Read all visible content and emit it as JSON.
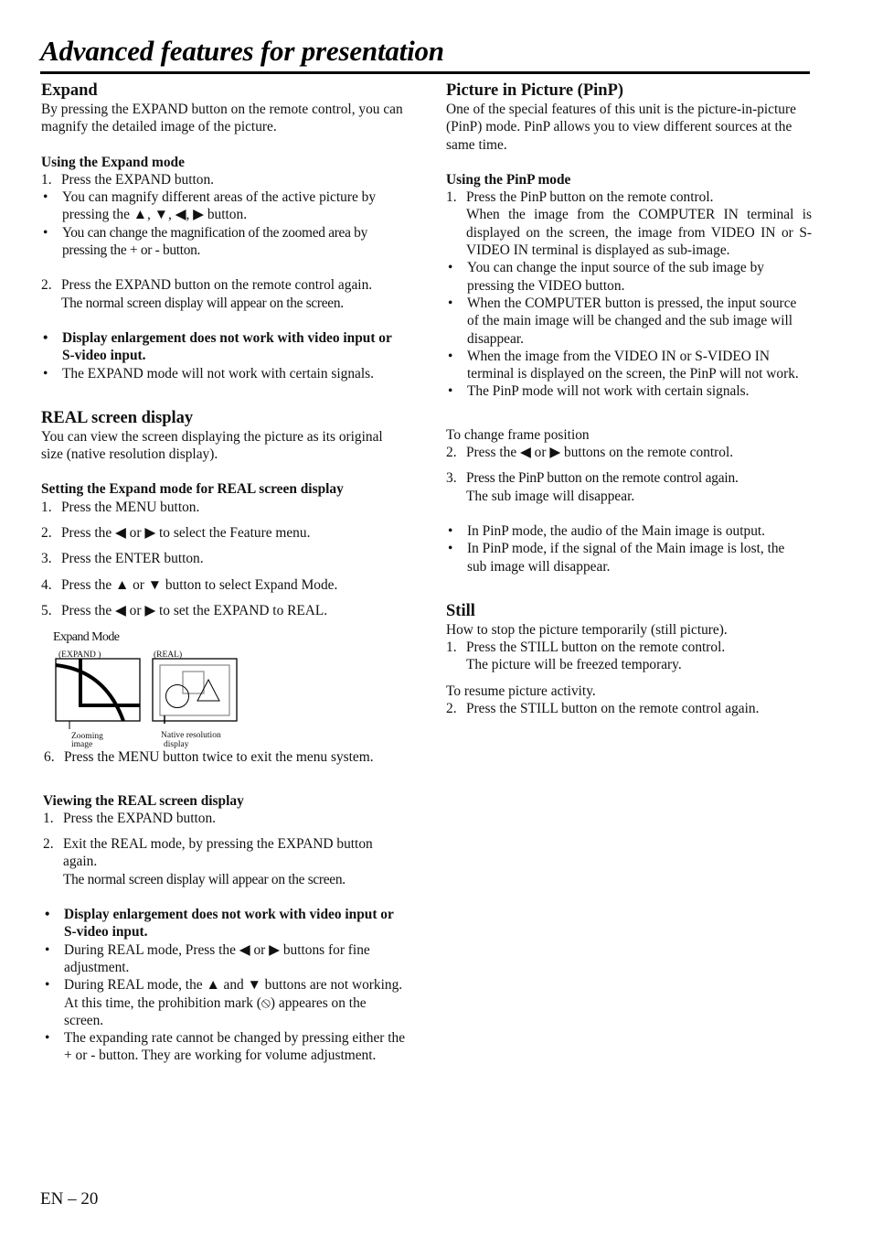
{
  "page": {
    "title": "Advanced features for presentation",
    "footer": "EN – 20"
  },
  "expand": {
    "heading": "Expand",
    "intro": "By pressing the EXPAND button on the remote control, you can magnify the detailed image of the picture.",
    "using_heading": "Using the Expand mode",
    "step1_num": "1.",
    "step1": "Press the EXPAND button.",
    "bullet1": "You can magnify different areas of the active picture by pressing the ▲, ▼, ◀, ▶ button.",
    "bullet2": "You can change the magnification of the zoomed area by pressing the + or - button.",
    "step2_num": "2.",
    "step2": "Press the EXPAND button on the remote control again.",
    "step2_note": "The normal screen display will appear on the screen.",
    "note1": "Display enlargement does not work with video input or S-video input.",
    "note2": "The EXPAND mode will not work with certain signals.",
    "bullet_mark": "•"
  },
  "real": {
    "heading": "REAL screen display",
    "intro": "You can view the screen displaying the picture as its original size (native resolution display).",
    "setting_heading": "Setting the Expand mode for REAL screen display",
    "steps": [
      {
        "num": "1.",
        "text": "Press the MENU button."
      },
      {
        "num": "2.",
        "text": "Press the ◀ or ▶ to select the Feature menu."
      },
      {
        "num": "3.",
        "text": "Press the ENTER button."
      },
      {
        "num": "4.",
        "text": "Press the  ▲ or ▼ button to select Expand Mode."
      },
      {
        "num": "5.",
        "text": "Press the ◀ or ▶ to set the EXPAND to REAL."
      }
    ],
    "diagram": {
      "title": "Expand Mode",
      "left_label": "(EXPAND )",
      "right_label": "(REAL)",
      "left_caption_1": "Zooming",
      "left_caption_2": "image",
      "right_caption_1": "Native resolution",
      "right_caption_2": "display"
    },
    "step6_num": "6.",
    "step6": "Press the MENU button twice to exit the menu system.",
    "viewing_heading": "Viewing the REAL screen display",
    "view_step1_num": "1.",
    "view_step1": "Press the EXPAND button.",
    "view_step2_num": "2.",
    "view_step2": "Exit the REAL mode, by pressing the EXPAND button again.",
    "view_step2_note": "The normal screen display will appear on the screen.",
    "note1": "Display enlargement does not work with video input or S-video input.",
    "note2": "During REAL mode, Press the ◀ or ▶ buttons for fine adjustment.",
    "note3": "During REAL mode, the ▲ and ▼ buttons are not working. At this time, the prohibition mark (⦸) appeares on the screen.",
    "note4": "The expanding rate cannot be changed by pressing either the + or - button. They are working for volume adjustment."
  },
  "pinp": {
    "heading": "Picture in Picture (PinP)",
    "intro": "One of the special features of this unit is the picture-in-picture (PinP) mode. PinP allows you to view different sources at the same time.",
    "using_heading": "Using the PinP mode",
    "step1_num": "1.",
    "step1": "Press the PinP button on the remote control.",
    "step1_note": "When the image from the COMPUTER IN terminal is displayed on the screen, the image from VIDEO IN or S-VIDEO IN terminal is displayed as sub-image.",
    "bullets": [
      "You can change the input source of the sub image by pressing the VIDEO button.",
      "When the COMPUTER button is pressed, the input source of the main image will be changed and the sub image will disappear.",
      "When the image from the VIDEO IN or S-VIDEO IN terminal is displayed on the screen, the PinP will not work.",
      "The PinP mode will not work with certain signals."
    ],
    "frame_heading": "To change frame position",
    "step2_num": "2.",
    "step2": "Press the ◀ or ▶ buttons on the remote control.",
    "step3_num": "3.",
    "step3": "Press the PinP button on the remote control again.",
    "step3_note": "The sub image will disappear.",
    "notes": [
      "In PinP mode, the audio of the Main image is output.",
      "In PinP mode, if the signal of the Main image is lost, the sub image will disappear."
    ]
  },
  "still": {
    "heading": "Still",
    "intro": "How to stop the picture temporarily (still picture).",
    "step1_num": "1.",
    "step1": "Press the STILL button on the remote control.",
    "step1_note": "The picture will be freezed temporary.",
    "resume_heading": "To resume picture activity.",
    "step2_num": "2.",
    "step2": "Press the STILL button on the remote control again."
  }
}
